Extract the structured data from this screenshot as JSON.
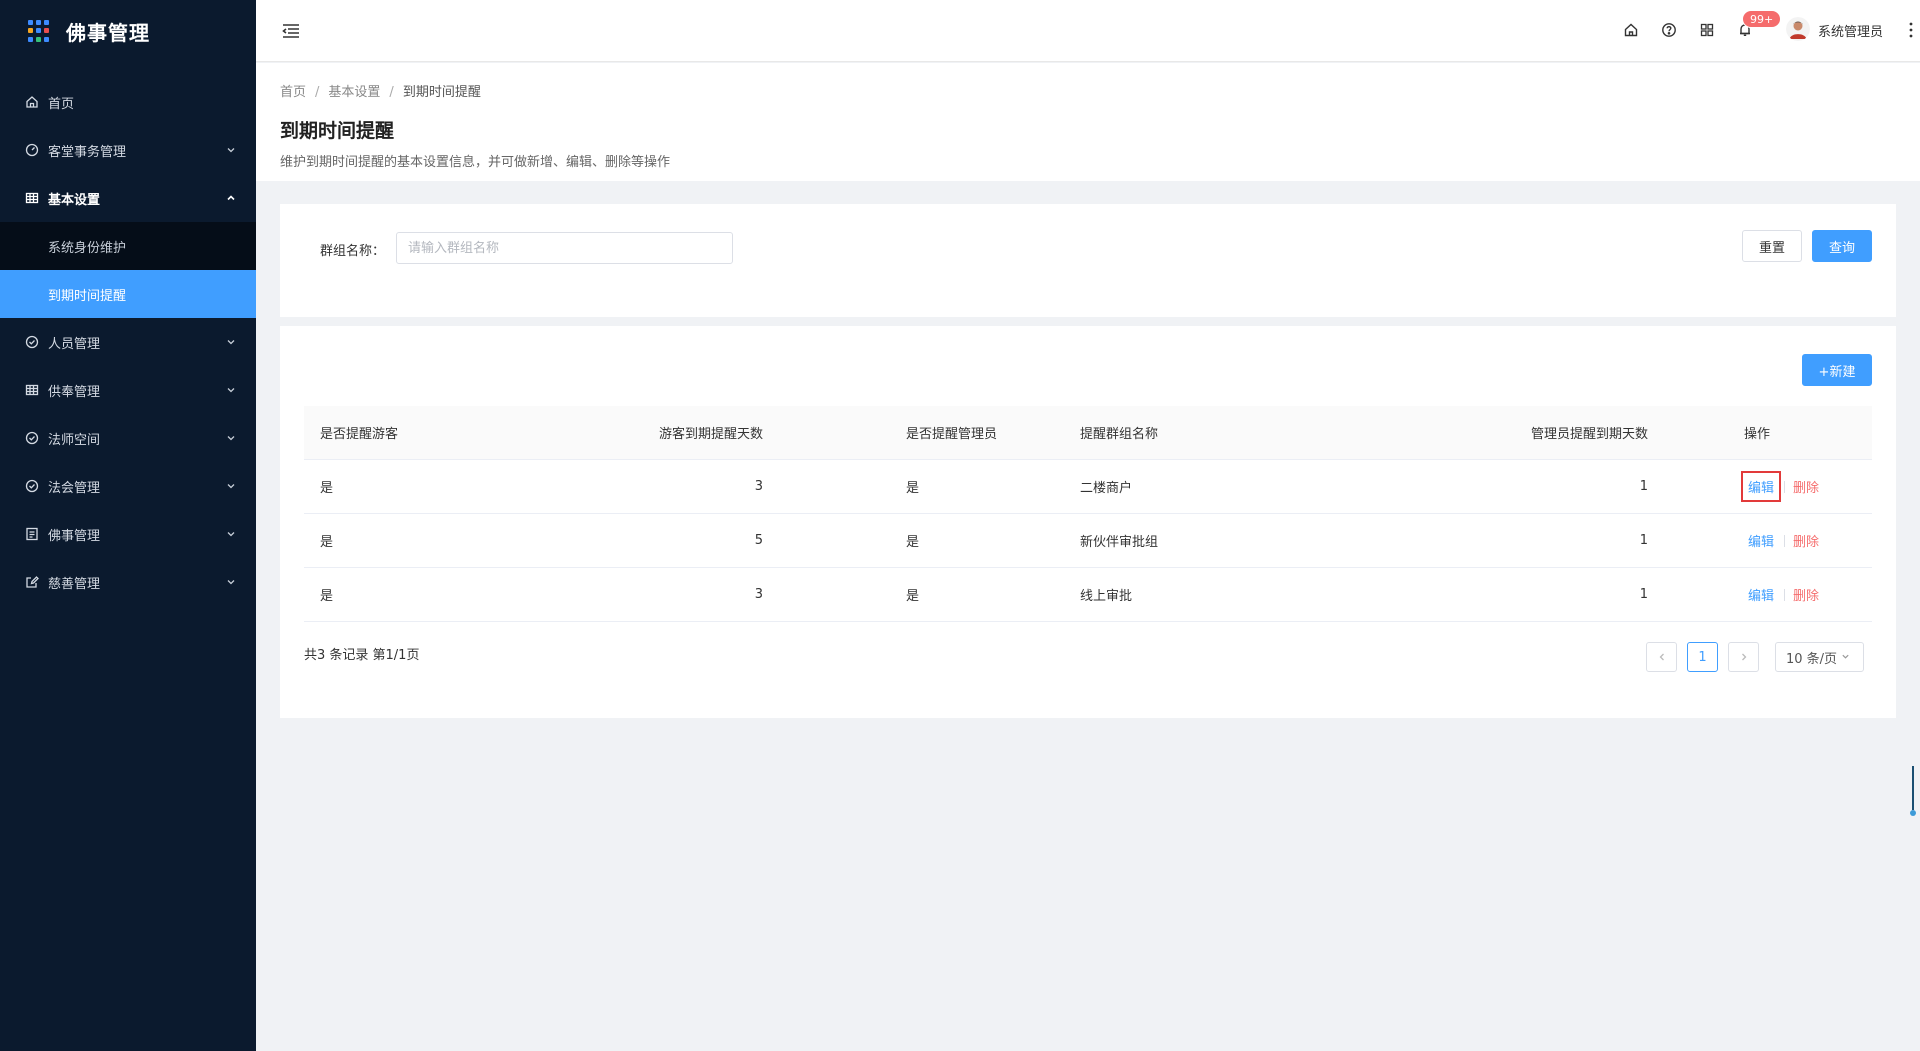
{
  "app": {
    "title": "佛事管理"
  },
  "sidebar": {
    "items": [
      {
        "label": "首页",
        "icon": "home-icon"
      },
      {
        "label": "客堂事务管理",
        "icon": "dashboard-icon"
      },
      {
        "label": "基本设置",
        "icon": "table-icon",
        "open": true,
        "children": [
          {
            "label": "系统身份维护"
          },
          {
            "label": "到期时间提醒",
            "active": true
          }
        ]
      },
      {
        "label": "人员管理",
        "icon": "check-circle-icon"
      },
      {
        "label": "供奉管理",
        "icon": "table-icon"
      },
      {
        "label": "法师空间",
        "icon": "check-circle-icon"
      },
      {
        "label": "法会管理",
        "icon": "check-circle-icon"
      },
      {
        "label": "佛事管理",
        "icon": "list-icon"
      },
      {
        "label": "慈善管理",
        "icon": "edit-icon"
      }
    ]
  },
  "header": {
    "badge": "99+",
    "username": "系统管理员"
  },
  "breadcrumb": [
    "首页",
    "基本设置",
    "到期时间提醒"
  ],
  "page": {
    "title": "到期时间提醒",
    "description": "维护到期时间提醒的基本设置信息，并可做新增、编辑、删除等操作"
  },
  "search": {
    "label": "群组名称：",
    "placeholder": "请输入群组名称",
    "value": "",
    "reset_label": "重置",
    "query_label": "查询"
  },
  "table": {
    "new_label": "+新建",
    "columns": [
      "是否提醒游客",
      "游客到期提醒天数",
      "是否提醒管理员",
      "提醒群组名称",
      "管理员提醒到期天数",
      "操作"
    ],
    "rows": [
      {
        "remind_visitor": "是",
        "visitor_days": "3",
        "remind_admin": "是",
        "group": "二楼商户",
        "admin_days": "1",
        "edit": "编辑",
        "delete": "删除"
      },
      {
        "remind_visitor": "是",
        "visitor_days": "5",
        "remind_admin": "是",
        "group": "新伙伴审批组",
        "admin_days": "1",
        "edit": "编辑",
        "delete": "删除"
      },
      {
        "remind_visitor": "是",
        "visitor_days": "3",
        "remind_admin": "是",
        "group": "线上审批",
        "admin_days": "1",
        "edit": "编辑",
        "delete": "删除"
      }
    ]
  },
  "pagination": {
    "total_text": "共3 条记录 第1/1页",
    "current": "1",
    "page_size": "10 条/页"
  },
  "colors": {
    "sidebar_bg": "#0b1a2e",
    "accent": "#409eff",
    "danger": "#f56c6c"
  }
}
